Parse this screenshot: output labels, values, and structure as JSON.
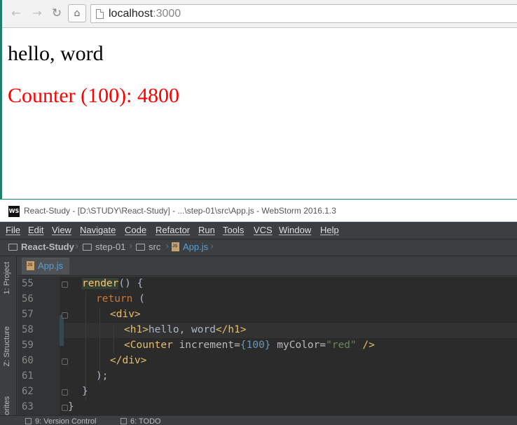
{
  "browser": {
    "url_host": "localhost",
    "url_port": ":3000",
    "icons": {
      "back": "arrow-left-icon",
      "forward": "arrow-right-icon",
      "reload": "reload-icon",
      "home": "home-icon",
      "page": "page-icon"
    },
    "page": {
      "heading": "hello, word",
      "counter": "Counter (100): 4800",
      "counter_color": "#ff0000"
    }
  },
  "ide": {
    "title": "React-Study - [D:\\STUDY\\React-Study] - ...\\step-01\\src\\App.js - WebStorm 2016.1.3",
    "logo": "WS",
    "menu": [
      "File",
      "Edit",
      "View",
      "Navigate",
      "Code",
      "Refactor",
      "Run",
      "Tools",
      "VCS",
      "Window",
      "Help"
    ],
    "breadcrumb": [
      "React-Study",
      "step-01",
      "src",
      "App.js"
    ],
    "side_tabs": {
      "project": "1: Project",
      "structure": "Z: Structure",
      "favorites": "orites"
    },
    "editor_tab": "App.js",
    "line_numbers": [
      "55",
      "56",
      "57",
      "58",
      "59",
      "60",
      "61",
      "62",
      "63"
    ],
    "code": {
      "l55_fn": "render",
      "l55_rest": "() {",
      "l56_kw": "return",
      "l56_rest": " (",
      "l57": "<div>",
      "l58_open": "<h1>",
      "l58_text": "hello, word",
      "l58_close": "</h1>",
      "l59_open": "<Counter",
      "l59_attr1": " increment=",
      "l59_num": "{100}",
      "l59_attr2": " myColor=",
      "l59_str": "\"red\"",
      "l59_close": " />",
      "l60": "</div>",
      "l61": ");",
      "l62": "}",
      "l63": "}"
    },
    "status_tabs": [
      "9: Version Control",
      "6: TODO"
    ]
  }
}
